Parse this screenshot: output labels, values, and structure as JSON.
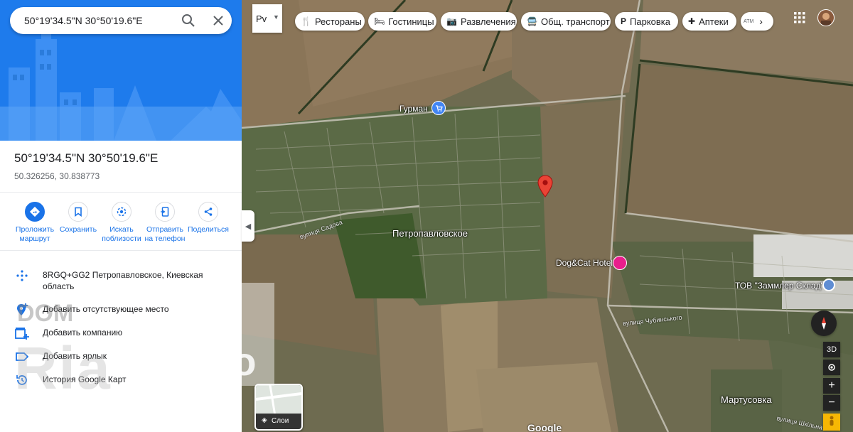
{
  "search": {
    "query": "50°19'34.5\"N 30°50'19.6\"E"
  },
  "place": {
    "title": "50°19'34.5\"N 30°50'19.6\"E",
    "decimal": "50.326256, 30.838773"
  },
  "actions": [
    {
      "label": "Проложить маршрут",
      "icon": "directions-icon"
    },
    {
      "label": "Сохранить",
      "icon": "bookmark-icon"
    },
    {
      "label": "Искать поблизости",
      "icon": "nearby-icon"
    },
    {
      "label": "Отправить на телефон",
      "icon": "send-to-phone-icon"
    },
    {
      "label": "Поделиться",
      "icon": "share-icon"
    }
  ],
  "info_rows": [
    {
      "text": "8RGQ+GG2 Петропавловское, Киевская область",
      "icon": "plus-code-icon"
    },
    {
      "text": "Добавить отсутствующее место",
      "icon": "add-place-icon"
    },
    {
      "text": "Добавить компанию",
      "icon": "add-business-icon"
    },
    {
      "text": "Добавить ярлык",
      "icon": "label-icon"
    },
    {
      "text": "История Google Карт",
      "icon": "history-icon"
    }
  ],
  "watermark": {
    "line1": "DOM",
    "line2": "Ria",
    "line3": "info"
  },
  "map": {
    "layer_button": "Рv",
    "chips": [
      {
        "label": "Рестораны",
        "icon": "restaurant-icon"
      },
      {
        "label": "Гостиницы",
        "icon": "hotel-icon"
      },
      {
        "label": "Развлечения",
        "icon": "camera-icon"
      },
      {
        "label": "Общ. транспорт",
        "icon": "transit-icon"
      },
      {
        "label": "Парковка",
        "icon": "parking-icon"
      },
      {
        "label": "Аптеки",
        "icon": "pharmacy-icon"
      },
      {
        "label": "ATM",
        "icon": "atm-icon"
      }
    ],
    "places": {
      "gurman": "Гурман",
      "village": "Петропавловское",
      "hotel": "Dog&Cat Hotel",
      "warehouse": "ТОВ \"Заммлер Склад\"",
      "martusovka": "Мартусовка"
    },
    "streets": {
      "sadova": "вулиця Садова",
      "chubynskoho": "вулиця Чубинського",
      "shkilna": "вулиця Шкільна"
    },
    "layers_thumb_label": "Слои",
    "ctrl_3d": "3D",
    "google_logo": "Google",
    "colors": {
      "accent": "#1a73e8",
      "pin": "#ea4335",
      "hotel_pin": "#e91e8c"
    }
  }
}
